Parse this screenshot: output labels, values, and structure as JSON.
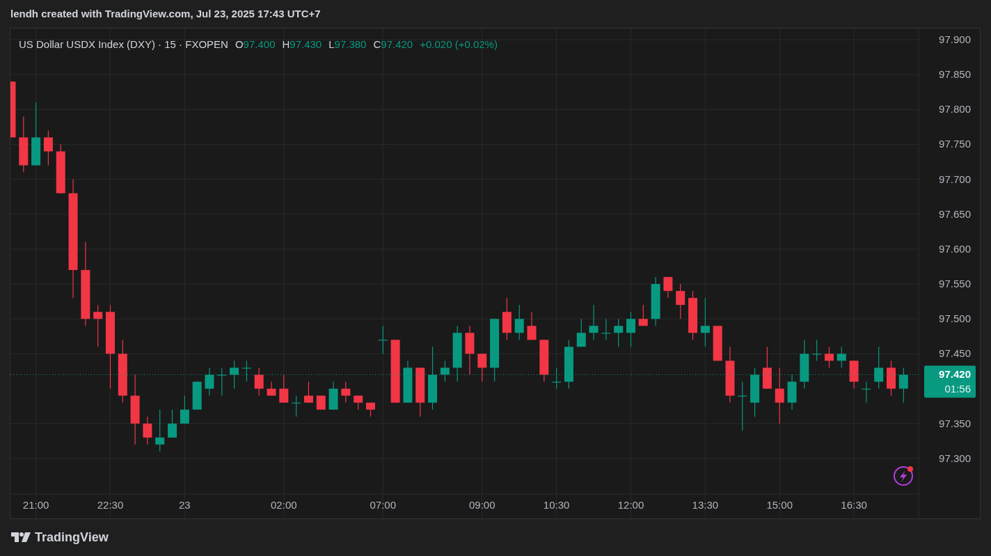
{
  "header": {
    "attribution": "lendh created with TradingView.com, Jul 23, 2025 17:43 UTC+7"
  },
  "legend": {
    "title": "US Dollar USDX Index (DXY) · 15 · FXOPEN",
    "ohlc": [
      {
        "label": "O",
        "value": "97.400"
      },
      {
        "label": "H",
        "value": "97.430"
      },
      {
        "label": "L",
        "value": "97.380"
      },
      {
        "label": "C",
        "value": "97.420"
      }
    ],
    "change": "+0.020 (+0.02%)"
  },
  "price_label": {
    "countdown": "01:56"
  },
  "chart_data": {
    "type": "candlestick",
    "categories": [
      null,
      null,
      "21:00",
      null,
      null,
      null,
      null,
      null,
      "22:30",
      null,
      null,
      null,
      null,
      null,
      "23",
      null,
      null,
      null,
      null,
      null,
      null,
      null,
      "02:00",
      null,
      null,
      null,
      null,
      null,
      null,
      null,
      "07:00",
      null,
      null,
      null,
      null,
      null,
      null,
      null,
      "09:00",
      null,
      null,
      null,
      null,
      null,
      "10:30",
      null,
      null,
      null,
      null,
      null,
      "12:00",
      null,
      null,
      null,
      null,
      null,
      "13:30",
      null,
      null,
      null,
      null,
      null,
      "15:00",
      null,
      null,
      null,
      null,
      null,
      "16:30",
      null,
      null,
      null,
      null
    ],
    "ohlc": [
      [
        97.84,
        97.84,
        97.76,
        97.76
      ],
      [
        97.76,
        97.79,
        97.71,
        97.72
      ],
      [
        97.72,
        97.81,
        97.72,
        97.76
      ],
      [
        97.76,
        97.77,
        97.72,
        97.74
      ],
      [
        97.74,
        97.75,
        97.68,
        97.68
      ],
      [
        97.68,
        97.7,
        97.53,
        97.57
      ],
      [
        97.57,
        97.61,
        97.49,
        97.5
      ],
      [
        97.51,
        97.52,
        97.46,
        97.5
      ],
      [
        97.51,
        97.52,
        97.4,
        97.45
      ],
      [
        97.45,
        97.47,
        97.38,
        97.39
      ],
      [
        97.39,
        97.42,
        97.32,
        97.35
      ],
      [
        97.35,
        97.36,
        97.32,
        97.33
      ],
      [
        97.32,
        97.37,
        97.31,
        97.33
      ],
      [
        97.33,
        97.37,
        97.33,
        97.35
      ],
      [
        97.35,
        97.39,
        97.35,
        97.37
      ],
      [
        97.37,
        97.41,
        97.37,
        97.41
      ],
      [
        97.4,
        97.43,
        97.39,
        97.42
      ],
      [
        97.42,
        97.43,
        97.39,
        97.42
      ],
      [
        97.42,
        97.44,
        97.4,
        97.43
      ],
      [
        97.43,
        97.44,
        97.41,
        97.43
      ],
      [
        97.42,
        97.43,
        97.39,
        97.4
      ],
      [
        97.4,
        97.41,
        97.39,
        97.39
      ],
      [
        97.4,
        97.42,
        97.38,
        97.38
      ],
      [
        97.38,
        97.39,
        97.36,
        97.38
      ],
      [
        97.39,
        97.41,
        97.38,
        97.38
      ],
      [
        97.39,
        97.39,
        97.37,
        97.37
      ],
      [
        97.37,
        97.41,
        97.37,
        97.4
      ],
      [
        97.4,
        97.41,
        97.38,
        97.39
      ],
      [
        97.39,
        97.39,
        97.37,
        97.38
      ],
      [
        97.38,
        97.38,
        97.36,
        97.37
      ],
      [
        97.47,
        97.49,
        97.45,
        97.47
      ],
      [
        97.47,
        97.47,
        97.38,
        97.38
      ],
      [
        97.38,
        97.44,
        97.38,
        97.43
      ],
      [
        97.43,
        97.43,
        97.36,
        97.38
      ],
      [
        97.38,
        97.46,
        97.37,
        97.42
      ],
      [
        97.42,
        97.44,
        97.41,
        97.43
      ],
      [
        97.43,
        97.49,
        97.41,
        97.48
      ],
      [
        97.48,
        97.49,
        97.42,
        97.45
      ],
      [
        97.45,
        97.45,
        97.41,
        97.43
      ],
      [
        97.43,
        97.5,
        97.41,
        97.5
      ],
      [
        97.51,
        97.53,
        97.47,
        97.48
      ],
      [
        97.48,
        97.52,
        97.47,
        97.5
      ],
      [
        97.49,
        97.51,
        97.47,
        97.47
      ],
      [
        97.47,
        97.47,
        97.41,
        97.42
      ],
      [
        97.41,
        97.43,
        97.4,
        97.41
      ],
      [
        97.41,
        97.47,
        97.4,
        97.46
      ],
      [
        97.46,
        97.5,
        97.46,
        97.48
      ],
      [
        97.48,
        97.52,
        97.47,
        97.49
      ],
      [
        97.48,
        97.5,
        97.47,
        97.48
      ],
      [
        97.48,
        97.5,
        97.46,
        97.49
      ],
      [
        97.48,
        97.51,
        97.46,
        97.5
      ],
      [
        97.5,
        97.52,
        97.49,
        97.49
      ],
      [
        97.5,
        97.56,
        97.49,
        97.55
      ],
      [
        97.56,
        97.56,
        97.53,
        97.54
      ],
      [
        97.54,
        97.55,
        97.5,
        97.52
      ],
      [
        97.53,
        97.54,
        97.47,
        97.48
      ],
      [
        97.48,
        97.53,
        97.46,
        97.49
      ],
      [
        97.49,
        97.49,
        97.44,
        97.44
      ],
      [
        97.44,
        97.46,
        97.38,
        97.39
      ],
      [
        97.39,
        97.41,
        97.34,
        97.39
      ],
      [
        97.38,
        97.43,
        97.36,
        97.42
      ],
      [
        97.43,
        97.46,
        97.4,
        97.4
      ],
      [
        97.4,
        97.43,
        97.35,
        97.38
      ],
      [
        97.38,
        97.42,
        97.37,
        97.41
      ],
      [
        97.41,
        97.47,
        97.4,
        97.45
      ],
      [
        97.45,
        97.47,
        97.44,
        97.45
      ],
      [
        97.45,
        97.46,
        97.43,
        97.44
      ],
      [
        97.44,
        97.46,
        97.43,
        97.45
      ],
      [
        97.44,
        97.44,
        97.4,
        97.41
      ],
      [
        97.4,
        97.41,
        97.38,
        97.4
      ],
      [
        97.41,
        97.46,
        97.4,
        97.43
      ],
      [
        97.43,
        97.44,
        97.39,
        97.4
      ],
      [
        97.4,
        97.43,
        97.38,
        97.42
      ]
    ],
    "ylim": [
      97.249,
      97.916
    ],
    "grid": true,
    "ref_lines": [
      {
        "axis": "y",
        "value": 97.42,
        "label": "97.420",
        "color": "#089981"
      }
    ],
    "yticks": [
      {
        "value": 97.9,
        "label": "97.900"
      },
      {
        "value": 97.85,
        "label": "97.850"
      },
      {
        "value": 97.8,
        "label": "97.800"
      },
      {
        "value": 97.75,
        "label": "97.750"
      },
      {
        "value": 97.7,
        "label": "97.700"
      },
      {
        "value": 97.65,
        "label": "97.650"
      },
      {
        "value": 97.6,
        "label": "97.600"
      },
      {
        "value": 97.55,
        "label": "97.550"
      },
      {
        "value": 97.5,
        "label": "97.500"
      },
      {
        "value": 97.45,
        "label": "97.450"
      },
      {
        "value": 97.35,
        "label": "97.350"
      },
      {
        "value": 97.3,
        "label": "97.300"
      }
    ]
  },
  "footer": {
    "logo_text": "TradingView"
  }
}
